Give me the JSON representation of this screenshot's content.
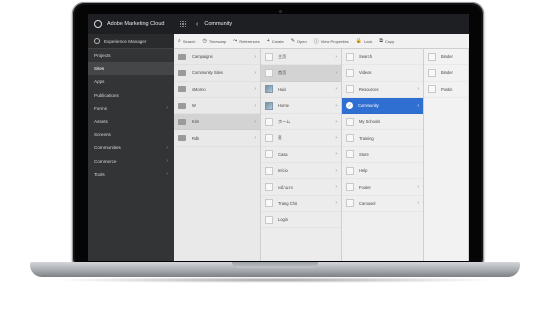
{
  "header": {
    "brand": "Adobe Marketing Cloud",
    "breadcrumb": "Community"
  },
  "sidebar": {
    "title": "Experience Manager",
    "items": [
      {
        "label": "Projects",
        "chevron": false,
        "active": false
      },
      {
        "label": "Sites",
        "chevron": false,
        "active": true
      },
      {
        "label": "Apps",
        "chevron": false,
        "active": false
      },
      {
        "label": "Publications",
        "chevron": false,
        "active": false
      },
      {
        "label": "Forms",
        "chevron": true,
        "active": false
      },
      {
        "label": "Assets",
        "chevron": false,
        "active": false
      },
      {
        "label": "Screens",
        "chevron": false,
        "active": false
      },
      {
        "label": "Communities",
        "chevron": true,
        "active": false
      },
      {
        "label": "Commerce",
        "chevron": true,
        "active": false
      },
      {
        "label": "Tools",
        "chevron": true,
        "active": false
      }
    ]
  },
  "toolbar": [
    {
      "icon": "search-icon",
      "glyph": "⌕",
      "label": "Search"
    },
    {
      "icon": "timewarp-icon",
      "glyph": "◷",
      "label": "Timewarp"
    },
    {
      "icon": "references-icon",
      "glyph": "⤳",
      "label": "References"
    },
    {
      "icon": "create-icon",
      "glyph": "+",
      "label": "Create"
    },
    {
      "icon": "open-icon",
      "glyph": "✎",
      "label": "Open"
    },
    {
      "icon": "info-icon",
      "glyph": "ⓘ",
      "label": "View Properties"
    },
    {
      "icon": "lock-icon",
      "glyph": "🔒",
      "label": "Lock"
    },
    {
      "icon": "copy-icon",
      "glyph": "⧉",
      "label": "Copy"
    }
  ],
  "columns": [
    [
      {
        "label": "Campaigns",
        "thumb": "folder",
        "chevron": true,
        "state": ""
      },
      {
        "label": "Community Sites",
        "thumb": "folder",
        "chevron": true,
        "state": ""
      },
      {
        "label": "sMorno",
        "thumb": "folder",
        "chevron": true,
        "state": ""
      },
      {
        "label": "W",
        "thumb": "folder",
        "chevron": true,
        "state": ""
      },
      {
        "label": "Kim",
        "thumb": "folder",
        "chevron": true,
        "state": "sel"
      },
      {
        "label": "Rdk",
        "thumb": "folder",
        "chevron": true,
        "state": ""
      }
    ],
    [
      {
        "label": "主页",
        "thumb": "page",
        "chevron": true,
        "state": ""
      },
      {
        "label": "首页",
        "thumb": "page",
        "chevron": true,
        "state": "sel"
      },
      {
        "label": "Huis",
        "thumb": "img",
        "chevron": true,
        "state": ""
      },
      {
        "label": "Home",
        "thumb": "img",
        "chevron": true,
        "state": ""
      },
      {
        "label": "ホーム",
        "thumb": "page",
        "chevron": true,
        "state": ""
      },
      {
        "label": "홈",
        "thumb": "page",
        "chevron": true,
        "state": ""
      },
      {
        "label": "Casa",
        "thumb": "page",
        "chevron": true,
        "state": ""
      },
      {
        "label": "Início",
        "thumb": "page",
        "chevron": true,
        "state": ""
      },
      {
        "label": "หน้าแรก",
        "thumb": "page",
        "chevron": true,
        "state": ""
      },
      {
        "label": "Trang Chủ",
        "thumb": "page",
        "chevron": true,
        "state": ""
      },
      {
        "label": "Login",
        "thumb": "page",
        "chevron": false,
        "state": ""
      }
    ],
    [
      {
        "label": "Search",
        "thumb": "page",
        "chevron": false,
        "state": ""
      },
      {
        "label": "Videos",
        "thumb": "page",
        "chevron": false,
        "state": ""
      },
      {
        "label": "Resources",
        "thumb": "page",
        "chevron": true,
        "state": ""
      },
      {
        "label": "Community",
        "thumb": "check",
        "chevron": true,
        "state": "hl"
      },
      {
        "label": "My Schools",
        "thumb": "page",
        "chevron": false,
        "state": ""
      },
      {
        "label": "Training",
        "thumb": "page",
        "chevron": false,
        "state": ""
      },
      {
        "label": "Store",
        "thumb": "page",
        "chevron": false,
        "state": ""
      },
      {
        "label": "Help",
        "thumb": "page",
        "chevron": false,
        "state": ""
      },
      {
        "label": "Footer",
        "thumb": "page",
        "chevron": true,
        "state": ""
      },
      {
        "label": "Carousel",
        "thumb": "page",
        "chevron": true,
        "state": ""
      }
    ],
    [
      {
        "label": "Binder",
        "thumb": "page",
        "chevron": false,
        "state": ""
      },
      {
        "label": "Binder",
        "thumb": "page",
        "chevron": false,
        "state": ""
      },
      {
        "label": "Postin",
        "thumb": "page",
        "chevron": false,
        "state": ""
      }
    ]
  ]
}
